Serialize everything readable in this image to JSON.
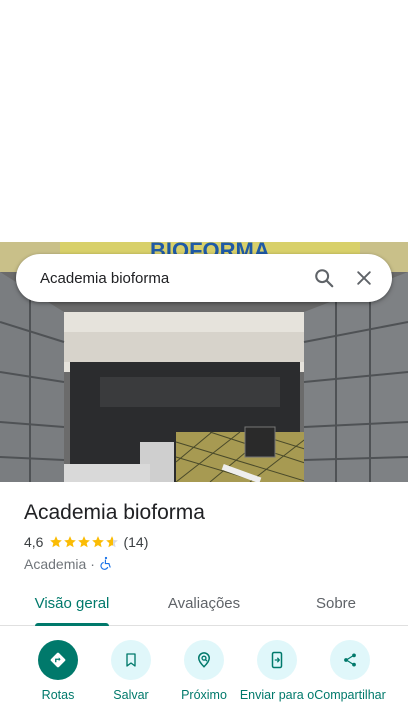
{
  "search": {
    "value": "Academia bioforma"
  },
  "photo": {
    "sign_text": "BIOFORMA"
  },
  "place": {
    "name": "Academia bioforma",
    "rating": "4,6",
    "rating_value": 4.6,
    "review_count": "(14)",
    "category": "Academia",
    "separator": "·"
  },
  "tabs": [
    {
      "label": "Visão geral",
      "active": true
    },
    {
      "label": "Avaliações",
      "active": false
    },
    {
      "label": "Sobre",
      "active": false
    }
  ],
  "actions": [
    {
      "label": "Rotas",
      "icon": "directions-icon"
    },
    {
      "label": "Salvar",
      "icon": "bookmark-icon"
    },
    {
      "label": "Próximo",
      "icon": "nearby-icon"
    },
    {
      "label": "Enviar para o",
      "icon": "send-to-phone-icon"
    },
    {
      "label": "Compartilhar",
      "icon": "share-icon"
    }
  ],
  "colors": {
    "accent": "#00796b",
    "star": "#fbbc04",
    "action_bg": "#e0f7fa",
    "accessible": "#1a73e8"
  }
}
